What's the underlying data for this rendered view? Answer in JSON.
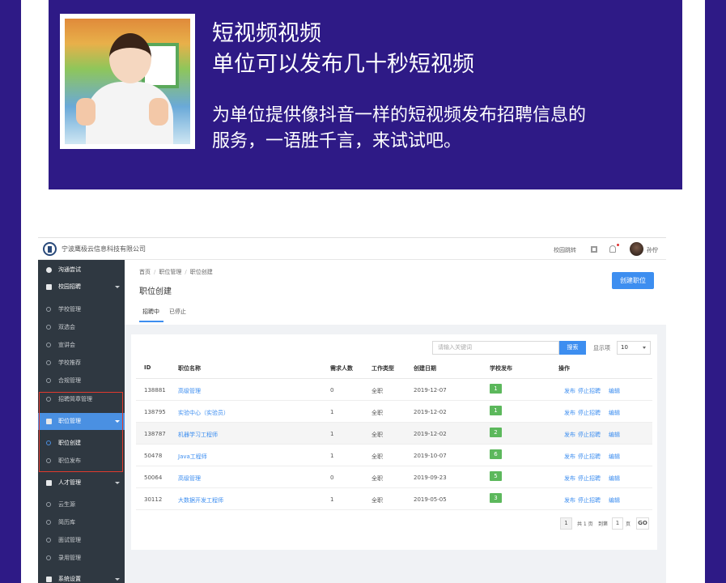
{
  "banner": {
    "title_line1": "短视频视频",
    "title_line2": "单位可以发布几十秒短视频",
    "desc_line1": "为单位提供像抖音一样的短视频发布招聘信息的",
    "desc_line2": "服务，一语胜千言，来试试吧。"
  },
  "topbar": {
    "company": "宁波鹰极云信息科技有限公司",
    "link": "校园跳转",
    "user": "孙佇"
  },
  "sidebar": {
    "items": [
      {
        "label": "沟通尝试"
      },
      {
        "label": "校园招聘"
      },
      {
        "label": "学校管理"
      },
      {
        "label": "双选会"
      },
      {
        "label": "宣讲会"
      },
      {
        "label": "学校推荐"
      },
      {
        "label": "合规管理"
      },
      {
        "label": "招聘简章管理"
      },
      {
        "label": "职位管理"
      },
      {
        "label": "职位创建"
      },
      {
        "label": "职位发布"
      },
      {
        "label": "人才管理"
      },
      {
        "label": "云生源"
      },
      {
        "label": "简历库"
      },
      {
        "label": "面试管理"
      },
      {
        "label": "录用管理"
      },
      {
        "label": "系统设置"
      }
    ]
  },
  "breadcrumb": [
    "首页",
    "职位管理",
    "职位创建"
  ],
  "page_title": "职位创建",
  "create_button": "创建职位",
  "tabs": [
    "招聘中",
    "已停止"
  ],
  "search": {
    "placeholder": "请输入关键词",
    "button": "搜索"
  },
  "page_size": {
    "label": "显示项",
    "value": "10"
  },
  "table": {
    "headers": [
      "ID",
      "职位名称",
      "需求人数",
      "工作类型",
      "创建日期",
      "学校发布",
      "操作"
    ],
    "rows": [
      {
        "id": "138881",
        "name": "高级管理",
        "count": "0",
        "type": "全职",
        "date": "2019-12-07",
        "published": "1"
      },
      {
        "id": "138795",
        "name": "实验中心（实验员）",
        "count": "1",
        "type": "全职",
        "date": "2019-12-02",
        "published": "1"
      },
      {
        "id": "138787",
        "name": "机器学习工程师",
        "count": "1",
        "type": "全职",
        "date": "2019-12-02",
        "published": "2"
      },
      {
        "id": "50478",
        "name": "Java工程师",
        "count": "1",
        "type": "全职",
        "date": "2019-10-07",
        "published": "6"
      },
      {
        "id": "50064",
        "name": "高级管理",
        "count": "0",
        "type": "全职",
        "date": "2019-09-23",
        "published": "5"
      },
      {
        "id": "30112",
        "name": "大数据开发工程师",
        "count": "1",
        "type": "全职",
        "date": "2019-05-05",
        "published": "3"
      }
    ],
    "ops": {
      "publish": "发布",
      "stop": "停止招聘",
      "edit": "编辑"
    }
  },
  "pagination": {
    "current": "1",
    "total_text": "共 1 页",
    "goto_label": "到第",
    "goto_value": "1",
    "page_unit": "页",
    "go_button": "GO"
  },
  "colors": {
    "banner": "#2e1a86",
    "primary": "#3d8ef0",
    "sidebar": "#2f3841",
    "badge": "#5cb85c",
    "highlight_box": "#e03a2e"
  }
}
